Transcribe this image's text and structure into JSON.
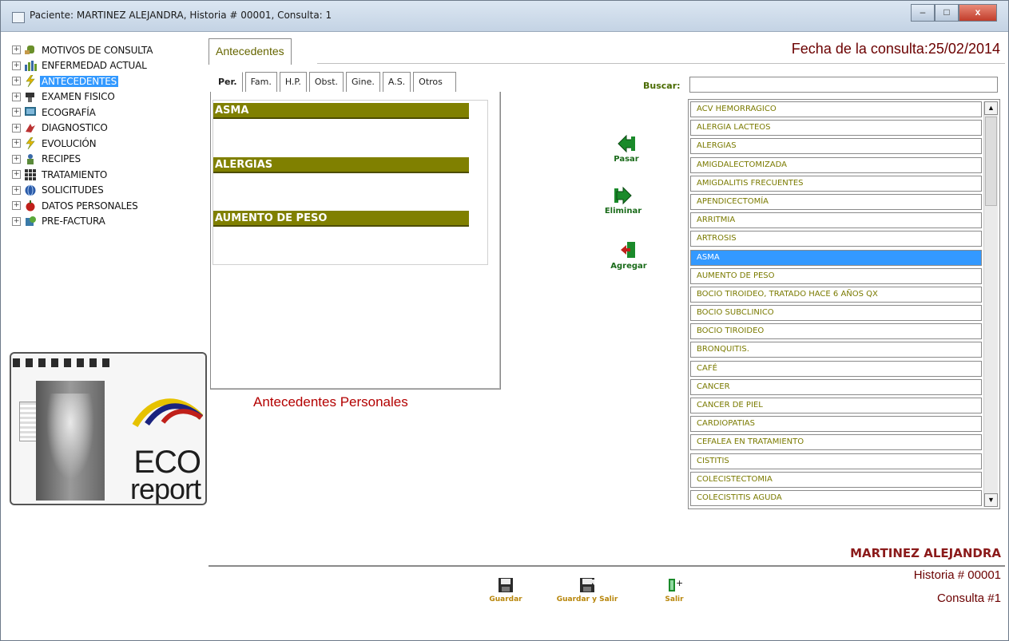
{
  "window": {
    "title": "Paciente: MARTINEZ ALEJANDRA, Historia # 00001, Consulta: 1",
    "minimize": "–",
    "maximize": "□",
    "close": "x"
  },
  "tree": {
    "items": [
      {
        "label": "MOTIVOS DE CONSULTA",
        "icon": "hand-icon",
        "selected": false
      },
      {
        "label": "ENFERMEDAD ACTUAL",
        "icon": "bar-chart-icon",
        "selected": false
      },
      {
        "label": "ANTECEDENTES",
        "icon": "lightning-icon",
        "selected": true
      },
      {
        "label": "EXAMEN FISICO",
        "icon": "stethoscope-icon",
        "selected": false
      },
      {
        "label": "ECOGRAFÍA",
        "icon": "monitor-icon",
        "selected": false
      },
      {
        "label": "DIAGNOSTICO",
        "icon": "diagnosis-icon",
        "selected": false
      },
      {
        "label": "EVOLUCIÓN",
        "icon": "lightning-icon",
        "selected": false
      },
      {
        "label": "RECIPES",
        "icon": "prescription-icon",
        "selected": false
      },
      {
        "label": "TRATAMIENTO",
        "icon": "grid-icon",
        "selected": false
      },
      {
        "label": "SOLICITUDES",
        "icon": "globe-icon",
        "selected": false
      },
      {
        "label": "DATOS PERSONALES",
        "icon": "apple-icon",
        "selected": false
      },
      {
        "label": "PRE-FACTURA",
        "icon": "invoice-icon",
        "selected": false
      }
    ]
  },
  "logo": {
    "line1": "ECO",
    "line2": "report"
  },
  "main_tab": "Antecedentes",
  "consult_date": "Fecha de la consulta:25/02/2014",
  "subtabs": [
    "Per.",
    "Fam.",
    "H.P.",
    "Obst.",
    "Gine.",
    "A.S.",
    "Otros"
  ],
  "selected_antecedentes": [
    {
      "header": "ASMA"
    },
    {
      "header": "ALERGIAS"
    },
    {
      "header": "AUMENTO DE PESO"
    }
  ],
  "panel_caption": "Antecedentes Personales",
  "actions": {
    "pasar": "Pasar",
    "eliminar": "Eliminar",
    "agregar": "Agregar"
  },
  "search": {
    "label": "Buscar:",
    "value": ""
  },
  "list": {
    "items": [
      "ACV HEMORRAGICO",
      "ALERGIA LACTEOS",
      "ALERGIAS",
      "AMIGDALECTOMIZADA",
      "AMIGDALITIS FRECUENTES",
      "APENDICECTOMÍA",
      "ARRITMIA",
      "ARTROSIS",
      "ASMA",
      "AUMENTO DE PESO",
      "BOCIO  TIROIDEO, TRATADO HACE 6  AÑOS QX",
      "BOCIO SUBCLINICO",
      "BOCIO TIROIDEO",
      "BRONQUITIS.",
      "CAFÉ",
      "CANCER",
      "CANCER  DE  PIEL",
      "CARDIOPATIAS",
      "CEFALEA EN TRATAMIENTO",
      "CISTITIS",
      "COLECISTECTOMIA",
      "COLECISTITIS AGUDA"
    ],
    "selected": "ASMA",
    "scroll_up": "▲",
    "scroll_down": "▼"
  },
  "patient": {
    "name": "MARTINEZ ALEJANDRA",
    "historia": "Historia # 00001",
    "consulta": "Consulta #1"
  },
  "bottom": {
    "guardar": "Guardar",
    "guardar_salir": "Guardar y Salir",
    "salir": "Salir"
  },
  "colors": {
    "accent_olive": "#808000",
    "selection_blue": "#3399ff",
    "title_red": "#6b0000"
  }
}
